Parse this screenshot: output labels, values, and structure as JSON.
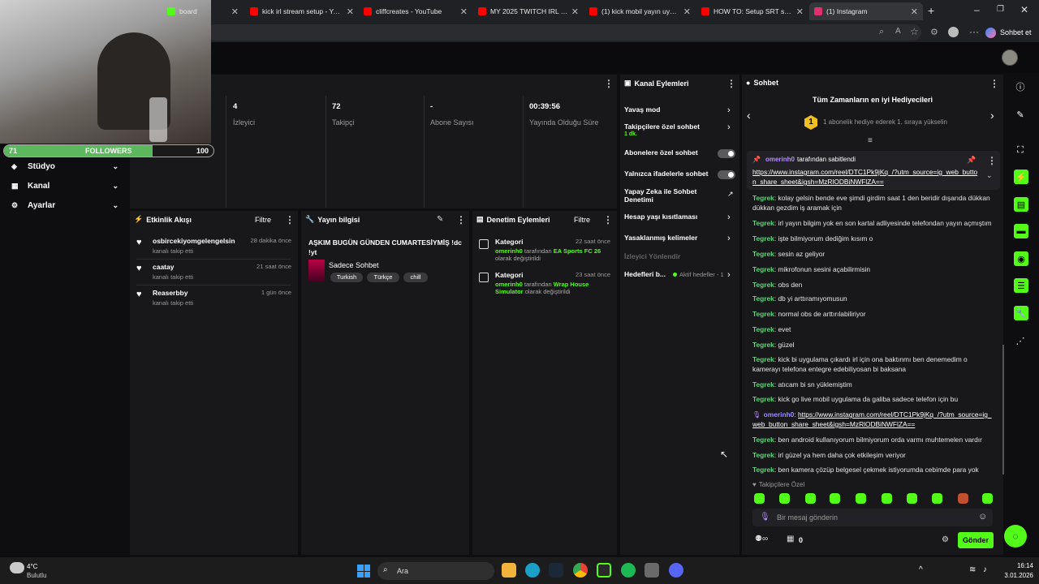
{
  "tabs": [
    {
      "label": "board",
      "color": "#53fc18"
    },
    {
      "label": "kick irl stream setup - YouTu",
      "color": "#ff0000"
    },
    {
      "label": "cliffcreates - YouTube",
      "color": "#ff0000"
    },
    {
      "label": "MY 2025 TWITCH IRL SETUP",
      "color": "#ff0000"
    },
    {
      "label": "(1) kick mobil yayın uyhulam",
      "color": "#ff0000"
    },
    {
      "label": "HOW TO: Setup SRT stream",
      "color": "#ff0000"
    },
    {
      "label": "(1) Instagram",
      "color": "#e1306c"
    }
  ],
  "browser": {
    "copilot_label": "Sohbet et"
  },
  "webcam": {
    "followers_current": "71",
    "followers_label": "FOLLOWERS",
    "followers_goal": "100",
    "progress": 0.71
  },
  "nav": [
    {
      "label": "Stüdyo",
      "icon": "studio-icon"
    },
    {
      "label": "Kanal",
      "icon": "channel-icon"
    },
    {
      "label": "Ayarlar",
      "icon": "gear-icon"
    }
  ],
  "stats": [
    {
      "value": "4",
      "label": "İzleyici"
    },
    {
      "value": "72",
      "label": "Takipçi"
    },
    {
      "value": "-",
      "label": "Abone Sayısı"
    },
    {
      "value": "00:39:56",
      "label": "Yayında Olduğu Süre"
    }
  ],
  "activity": {
    "title": "Etkinlik Akışı",
    "filter": "Filtre",
    "items": [
      {
        "user": "osbircekiyomgelengelsin",
        "time": "28 dakika önce",
        "action": "kanalı takip etti"
      },
      {
        "user": "caatay",
        "time": "21 saat önce",
        "action": "kanalı takip etti"
      },
      {
        "user": "Reaserbby",
        "time": "1 gün önce",
        "action": "kanalı takip etti"
      }
    ]
  },
  "stream_info": {
    "title": "Yayın bilgisi",
    "stream_title": "AŞKIM BUGÜN GÜNDEN CUMARTESİYMİŞ !dc !yt",
    "category": "Sadece Sohbet",
    "tags": [
      "Turkish",
      "Türkçe",
      "chill"
    ]
  },
  "moderation": {
    "title": "Denetim Eylemleri",
    "filter": "Filtre",
    "items": [
      {
        "label": "Kategori",
        "time": "22 saat önce",
        "user": "omerinh0",
        "mid": "tarafından",
        "target": "EA Sports FC 26",
        "suffix": "olarak değiştirildi"
      },
      {
        "label": "Kategori",
        "time": "23 saat önce",
        "user": "omerinh0",
        "mid": "tarafından",
        "target": "Wrap House Simulator",
        "suffix": "olarak değiştirildi"
      }
    ]
  },
  "channel_actions": {
    "title": "Kanal Eylemleri",
    "slow": "Yavaş mod",
    "follower_only": "Takipçilere özel sohbet",
    "follower_only_sub": "1 dk.",
    "sub_only": "Abonelere özel sohbet",
    "emote_only": "Yalnızca ifadelerle sohbet",
    "ai_mod": "Yapay Zeka ile Sohbet Denetimi",
    "age": "Hesap yaşı kısıtlaması",
    "banned": "Yasaklanmış kelimeler",
    "viewer_redirect": "İzleyici Yönlendir",
    "goals": "Hedefleri b...",
    "goals_status": "Aktif hedefler - 1"
  },
  "chat": {
    "title": "Sohbet",
    "gifters_title": "Tüm Zamanların en iyi Hediyecileri",
    "gifters_rank": "1",
    "gifters_text": "1 abonelik hediye ederek 1. sıraya yükselin",
    "pinned_by_user": "omerinh0",
    "pinned_by_text": "tarafından sabitlendi",
    "pinned_link": "https://www.instagram.com/reel/DTC1Pk9jKq_/?utm_source=ig_web_button_share_sheet&igsh=MzRlODBiNWFlZA==",
    "messages": [
      {
        "user": "Tegrek",
        "text": "kolay gelsin bende eve şimdi girdim saat 1 den beridir dışarıda dükkan dükkan gezdim iş aramak için"
      },
      {
        "user": "Tegrek",
        "text": "irl yayın bilgim yok en son kartal adliyesinde telefondan yayın açmıştım"
      },
      {
        "user": "Tegrek",
        "text": "işte bilmiyorum dediğim kısım o"
      },
      {
        "user": "Tegrek",
        "text": "sesin az geliyor"
      },
      {
        "user": "Tegrek",
        "text": "mikrofonun sesini açabilirmisin"
      },
      {
        "user": "Tegrek",
        "text": "obs den"
      },
      {
        "user": "Tegrek",
        "text": "db yi arttıramıyomusun"
      },
      {
        "user": "Tegrek",
        "text": "normal obs de arttırılabiliriyor"
      },
      {
        "user": "Tegrek",
        "text": "evet"
      },
      {
        "user": "Tegrek",
        "text": "güzel"
      },
      {
        "user": "Tegrek",
        "text": "kick bi uygulama çıkardı irl için ona baktınmı ben denemedim o kamerayı telefona entegre edebiliyosan bi baksana"
      },
      {
        "user": "Tegrek",
        "text": "atıcam bi sn yüklemiştim"
      },
      {
        "user": "Tegrek",
        "text": "kick go live mobil uygulama da galiba sadece telefon için bu"
      },
      {
        "user": "omerinh0",
        "text": "https://www.instagram.com/reel/DTC1Pk9jKq_/?utm_source=ig_web_button_share_sheet&igsh=MzRlODBiNWFlZA=="
      },
      {
        "user": "Tegrek",
        "text": "ben android kullanıyorum bilmiyorum orda varmı muhtemelen vardır"
      },
      {
        "user": "Tegrek",
        "text": "irl güzel ya hem daha çok etkileşim veriyor"
      },
      {
        "user": "Tegrek",
        "text": "ben kamera çözüp belgesel çekmek istiyorumda cebimde para yok"
      }
    ],
    "follower_only_label": "Takipçilere Özel",
    "input_placeholder": "Bir mesaj gönderin",
    "points": "0",
    "send": "Gönder"
  },
  "taskbar": {
    "weather_temp": "4°C",
    "weather_desc": "Bulutlu",
    "search": "Ara",
    "time": "16:14",
    "date": "3.01.2026"
  }
}
